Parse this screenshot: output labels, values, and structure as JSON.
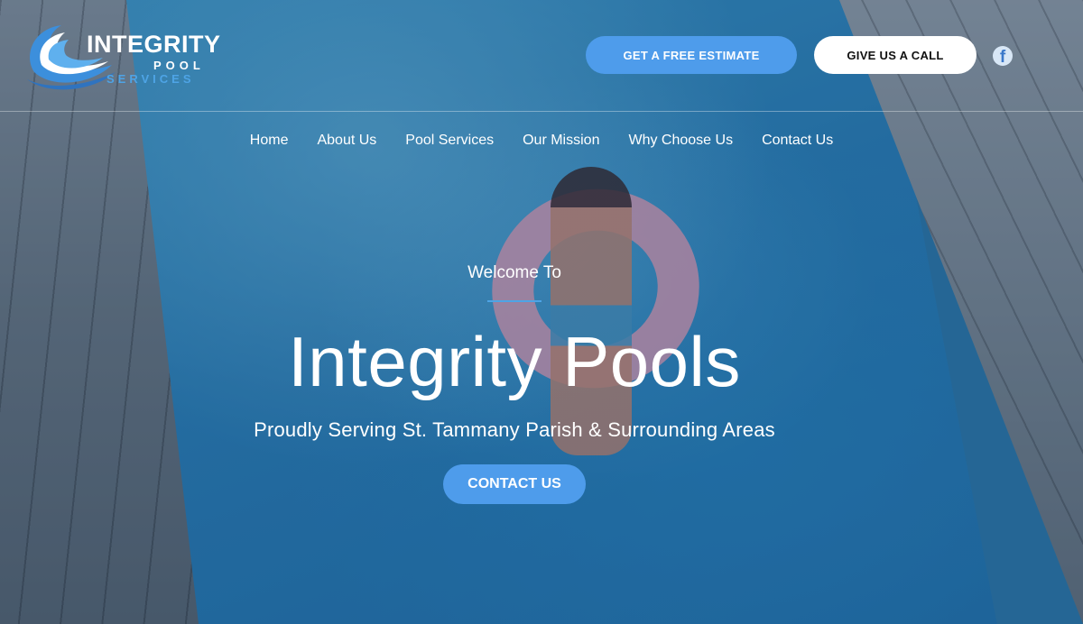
{
  "logo": {
    "word": "INTEGRITY",
    "pool": "POOL",
    "services": "SERVICES"
  },
  "header": {
    "estimate_label": "GET A FREE ESTIMATE",
    "call_label": "GIVE US A CALL",
    "social_icon": "facebook-icon"
  },
  "nav": {
    "items": [
      {
        "label": "Home"
      },
      {
        "label": "About Us"
      },
      {
        "label": "Pool Services"
      },
      {
        "label": "Our Mission"
      },
      {
        "label": "Why Choose Us"
      },
      {
        "label": "Contact Us"
      }
    ]
  },
  "hero": {
    "welcome": "Welcome To",
    "title": "Integrity Pools",
    "subtitle": "Proudly Serving St. Tammany Parish & Surrounding Areas",
    "cta_label": "CONTACT US"
  },
  "colors": {
    "accent": "#4e9ceb",
    "logo_blue": "#4ea4e6",
    "white_button": "#ffffff"
  }
}
